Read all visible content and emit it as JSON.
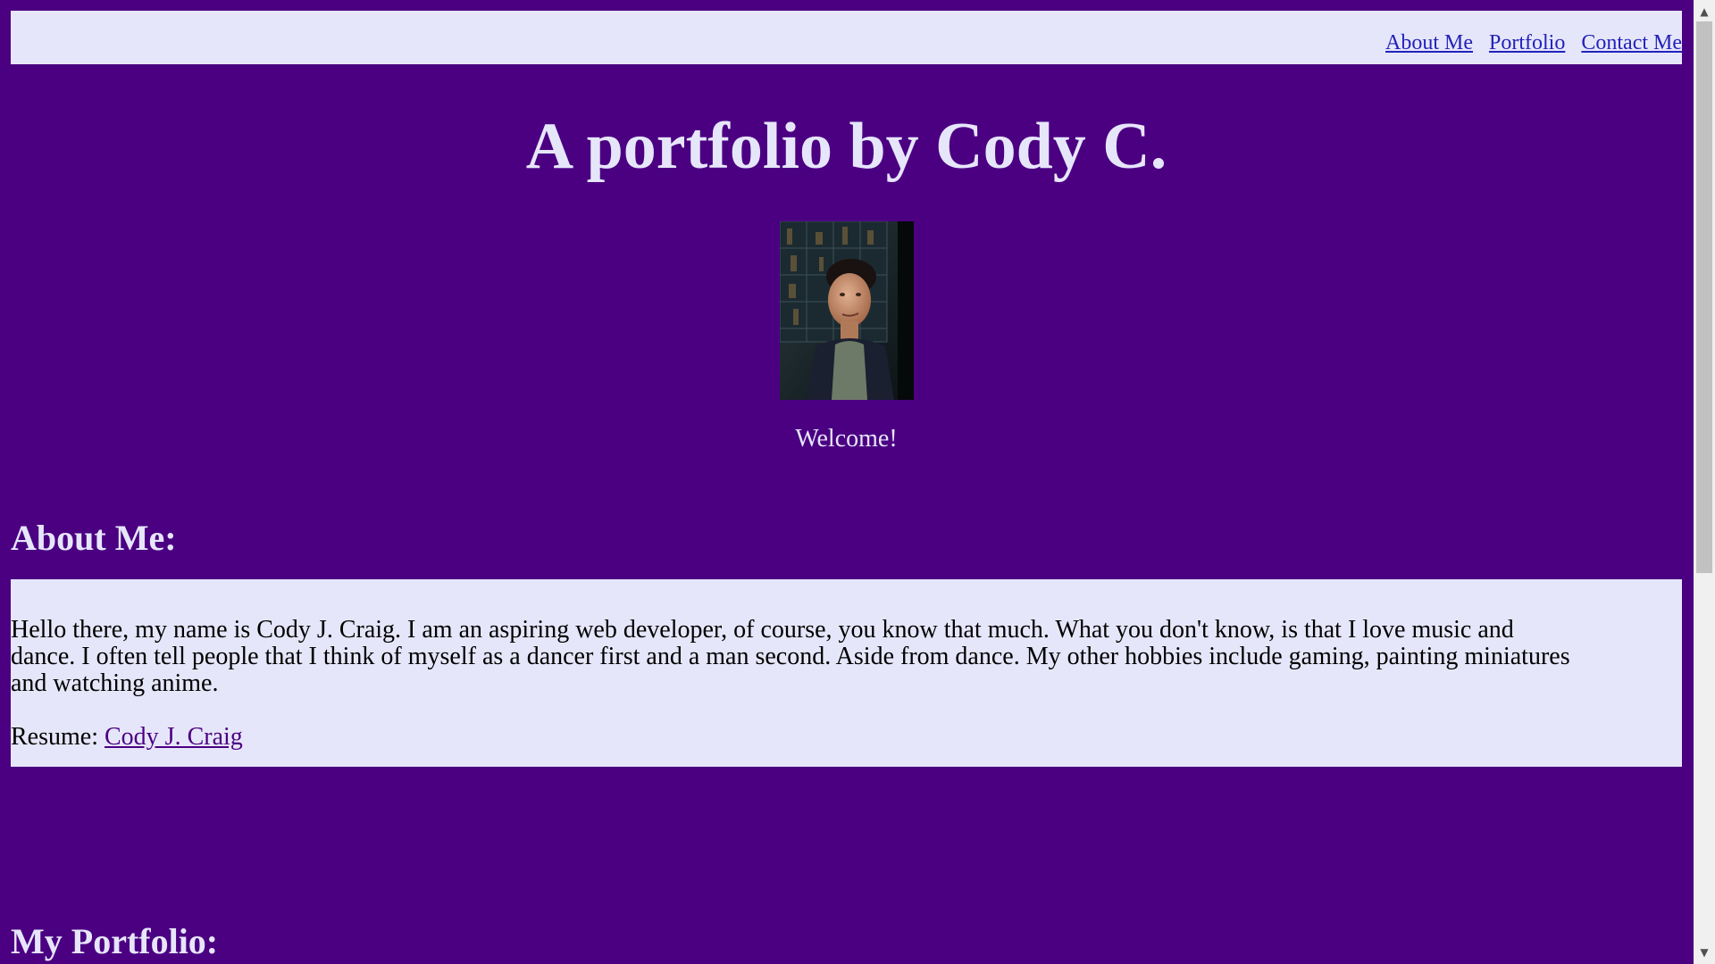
{
  "nav": {
    "items": [
      "About Me",
      "Portfolio",
      "Contact Me"
    ]
  },
  "hero": {
    "title": "A portfolio by Cody C.",
    "welcome": "Welcome!"
  },
  "about": {
    "heading": "About Me:",
    "line1": "Hello there, my name is Cody J. Craig. I am an aspiring web developer, of course, you know that much. What you don't know, is that I love music and",
    "line2": "dance. I often tell people that I think of myself as a dancer first and a man second. Aside from dance. My other hobbies include gaming, painting miniatures",
    "line3": "and watching anime.",
    "resume_label": "Resume: ",
    "resume_link": "Cody J. Craig"
  },
  "portfolio": {
    "heading": "My Portfolio:"
  },
  "colors": {
    "background": "#4b0082",
    "panel": "#e6e6fa",
    "nav_link": "#2222bb"
  },
  "icons": {
    "scroll_up": "scroll-up-arrow-icon",
    "scroll_down": "scroll-down-arrow-icon"
  }
}
